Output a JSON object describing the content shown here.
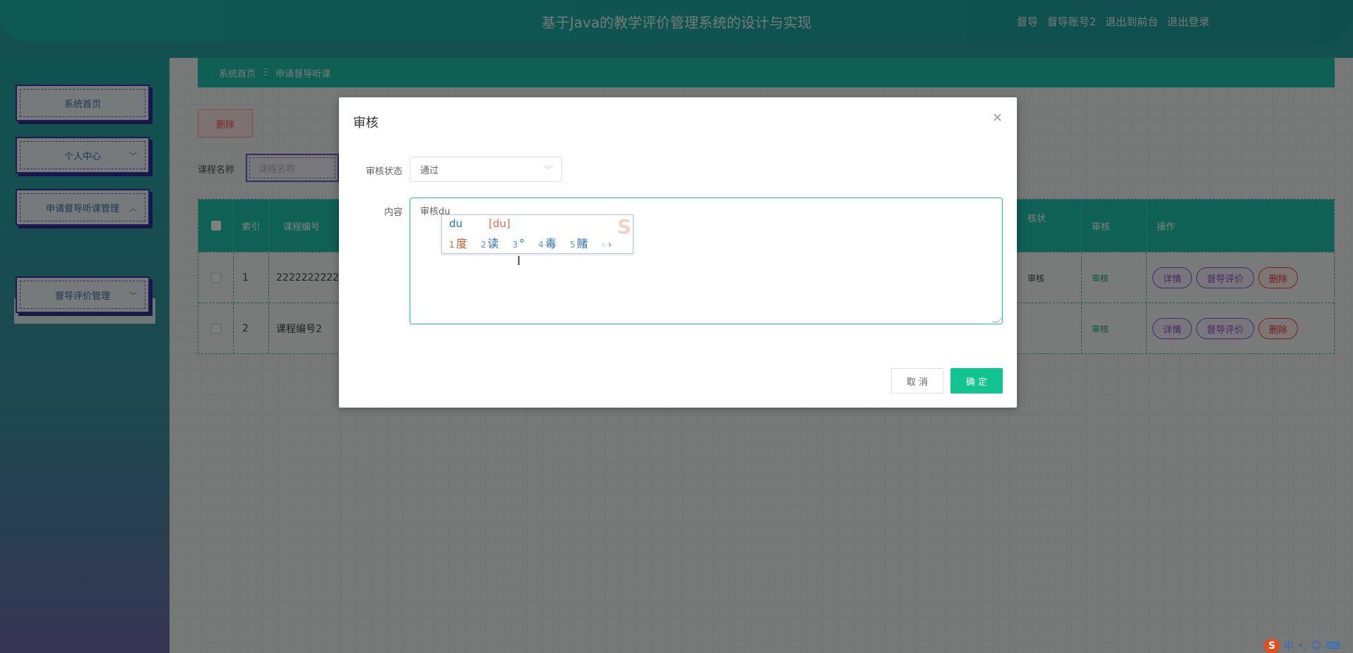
{
  "header": {
    "title": "基于Java的教学评价管理系统的设计与实现",
    "role": "督导",
    "account": "督导账号2",
    "back_frontend": "退出到前台",
    "logout": "退出登录"
  },
  "sidebar": {
    "items": [
      {
        "label": "系统首页"
      },
      {
        "label": "个人中心"
      },
      {
        "label": "申请督导听课管理"
      },
      {
        "label": "督导评价管理"
      }
    ],
    "submenu_label": "申请督导听课"
  },
  "breadcrumb": {
    "home": "系统首页",
    "separator": "Ξ",
    "current": "申请督导听课"
  },
  "toolbar": {
    "delete_label": "删除",
    "search_label": "课程名称",
    "search_placeholder": "课程名称"
  },
  "table": {
    "headers": {
      "index": "索引",
      "course_no": "课程编号",
      "audit_status": "核状",
      "audit": "审核",
      "action": "操作"
    },
    "rows": [
      {
        "index": "1",
        "course_no": "2222222222",
        "audit_status": "审核",
        "audit": "审核"
      },
      {
        "index": "2",
        "course_no": "课程编号2",
        "audit_status": "",
        "audit": "审核"
      }
    ],
    "actions": {
      "detail": "详情",
      "evaluate": "督导评价",
      "delete": "删除"
    }
  },
  "dialog": {
    "title": "审核",
    "close": "×",
    "status_label": "审核状态",
    "status_value": "通过",
    "content_label": "内容",
    "content_value": "审核du",
    "cancel_label": "取 消",
    "ok_label": "确 定"
  },
  "ime": {
    "composition": "du",
    "pinyin": "[du]",
    "candidates": [
      {
        "n": "1",
        "text": "度"
      },
      {
        "n": "2",
        "text": "读"
      },
      {
        "n": "3",
        "text": "°"
      },
      {
        "n": "4",
        "text": "毒"
      },
      {
        "n": "5",
        "text": "赌"
      }
    ],
    "prev": "‹",
    "next": "›"
  },
  "tray": {
    "logo": "S",
    "lang": "中",
    "punct": "•,",
    "emoji": "☺",
    "keyboard": "⌨"
  },
  "colors": {
    "accent": "#1ec3ad",
    "ok_button": "#12c48f",
    "danger": "#e23a3a"
  }
}
